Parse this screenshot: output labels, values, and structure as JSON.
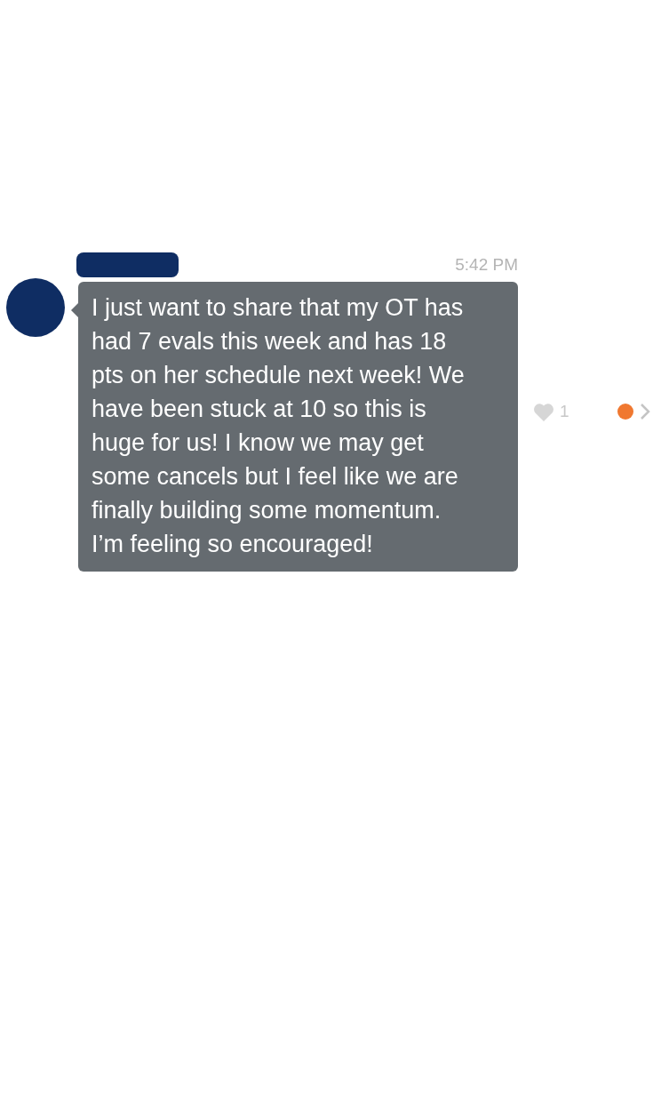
{
  "message": {
    "time": "5:42 PM",
    "text": "I just want to share that my OT has had 7 evals this week and has 18 pts on her schedule next week! We have been stuck at 10 so this is huge for us! I know we may get some cancels but I feel like we are finally building some momentum. I’m feeling so encouraged!",
    "like_count": "1",
    "liked": false,
    "unread": true
  }
}
